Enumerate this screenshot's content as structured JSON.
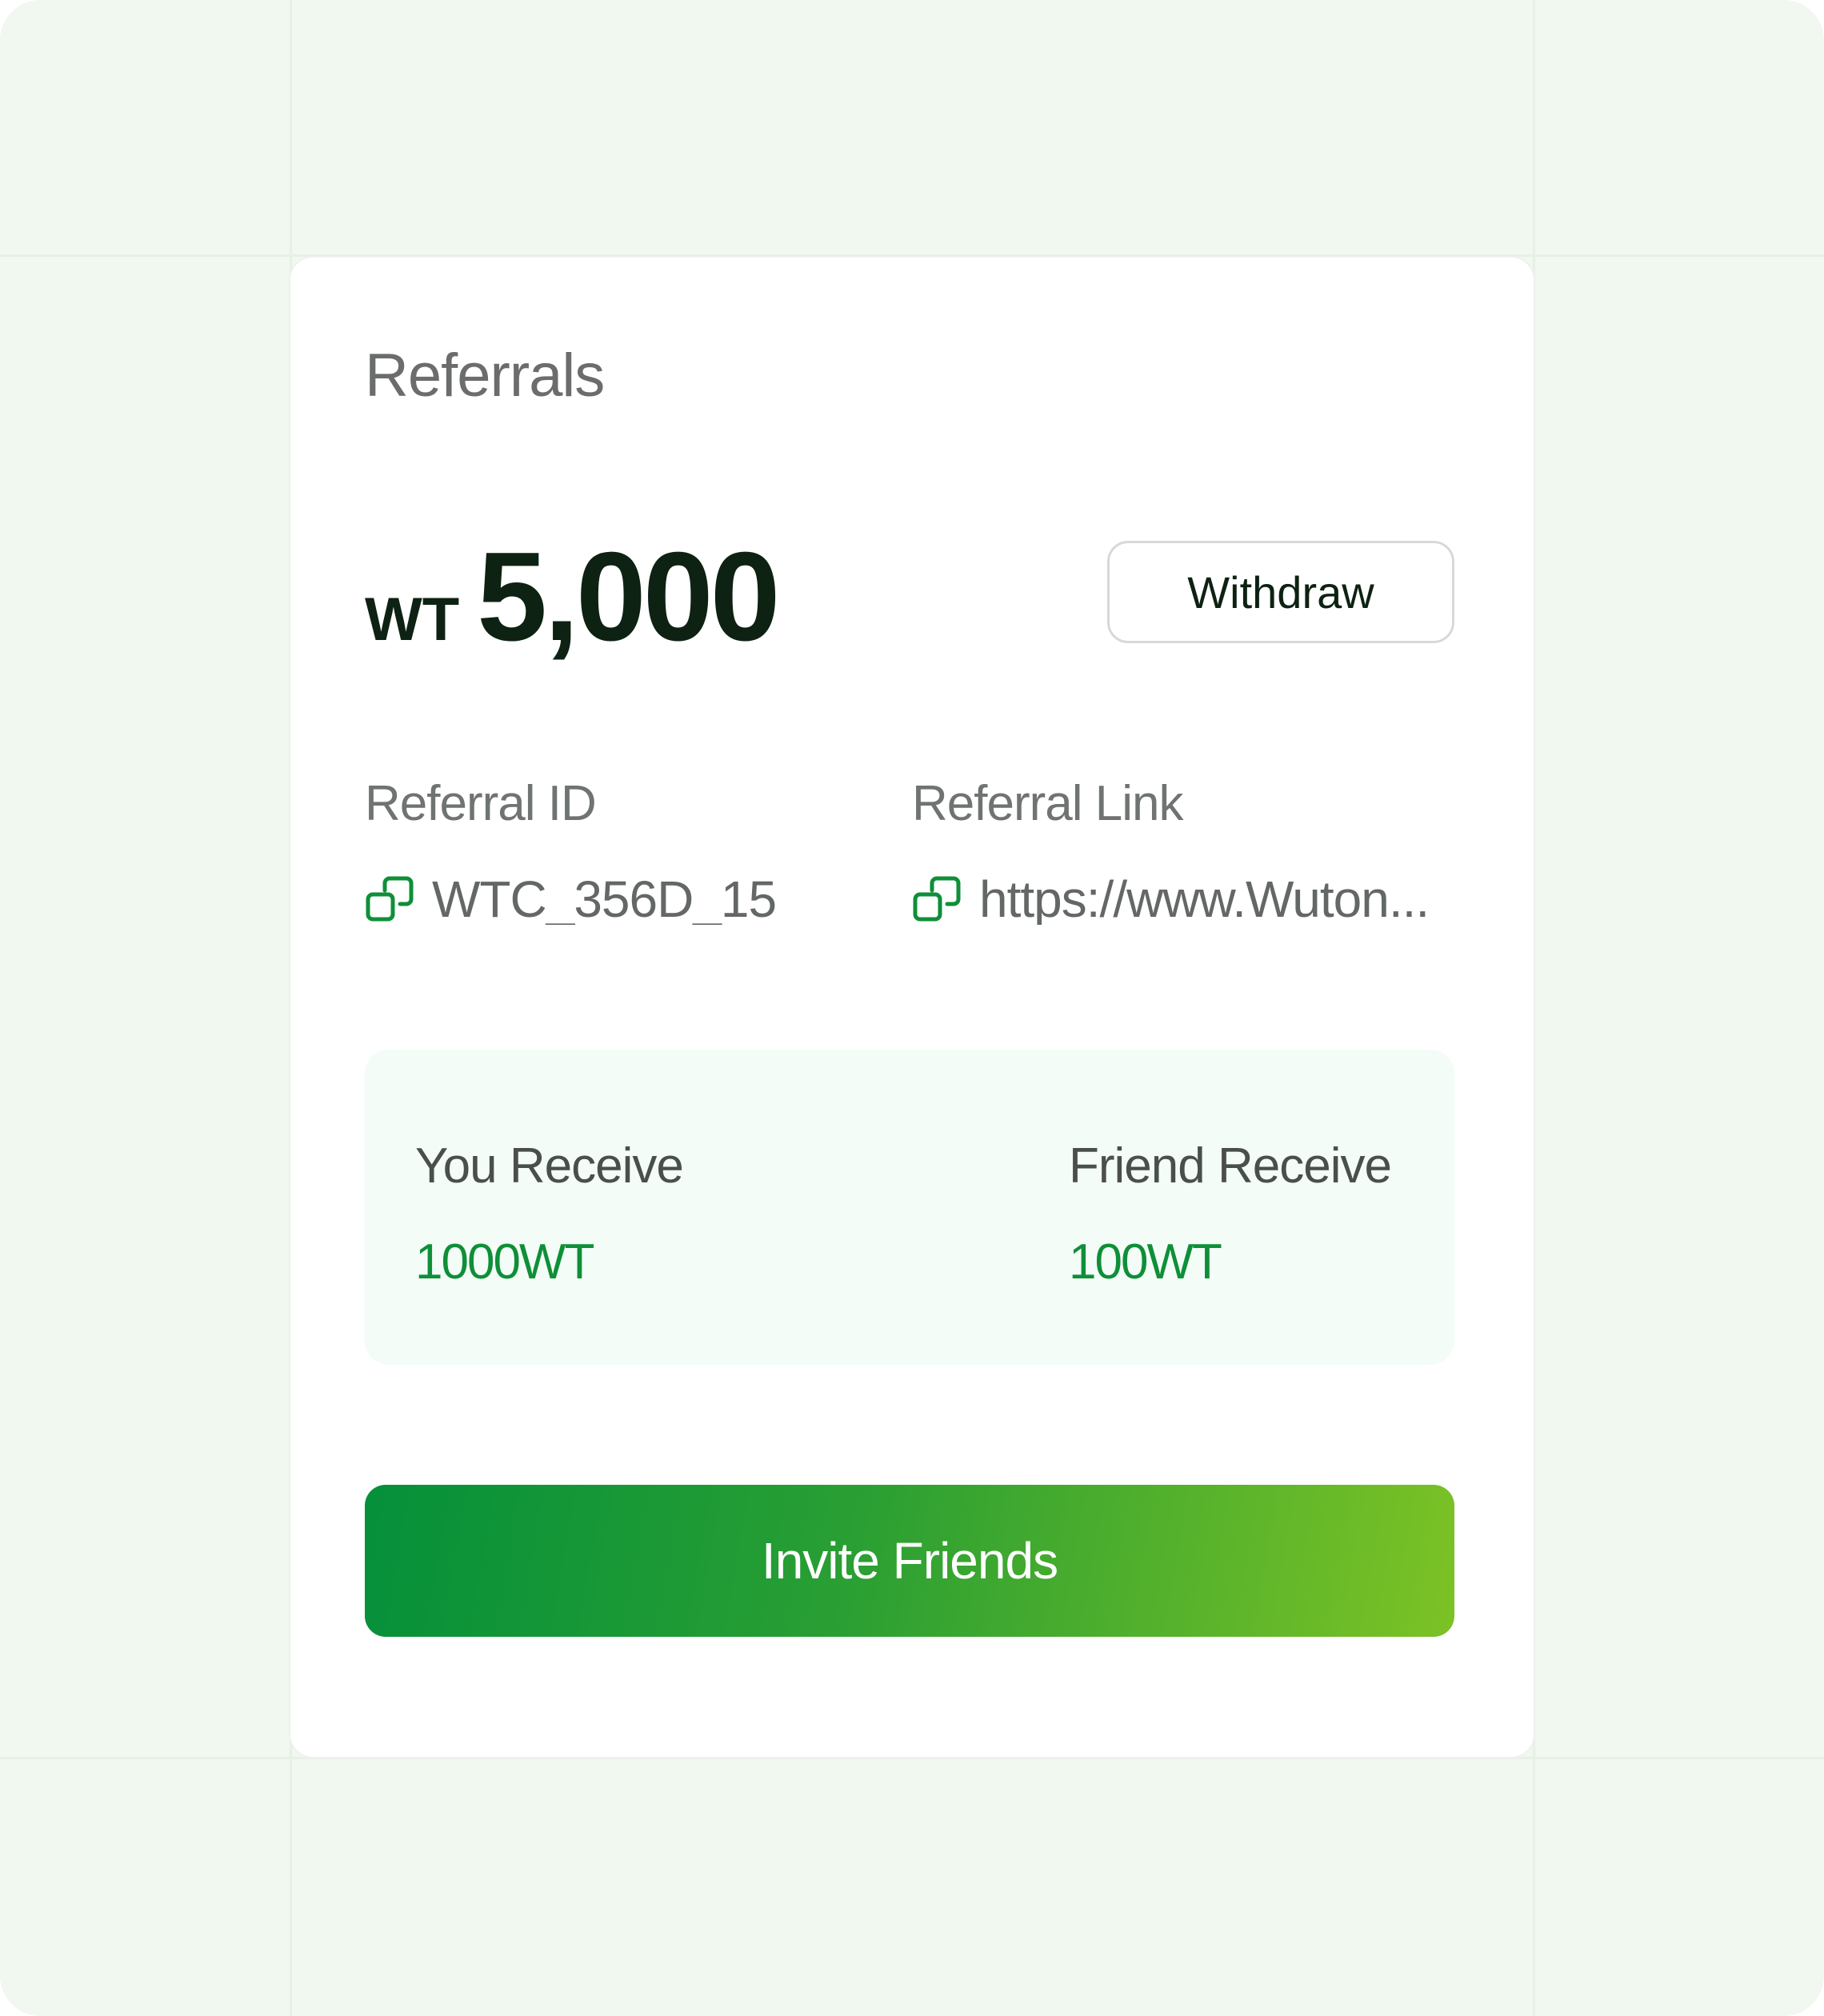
{
  "referrals": {
    "title": "Referrals",
    "balance": {
      "currency": "WT",
      "amount": "5,000"
    },
    "withdraw_label": "Withdraw",
    "referral_id": {
      "label": "Referral ID",
      "value": "WTC_356D_15"
    },
    "referral_link": {
      "label": "Referral Link",
      "value": "https://www.Wuton..."
    },
    "rewards": {
      "you_label": "You Receive",
      "you_value": "1000WT",
      "friend_label": "Friend Receive",
      "friend_value": "100WT"
    },
    "invite_label": "Invite Friends"
  },
  "colors": {
    "accent": "#0e8f38",
    "gradient_start": "#05903a",
    "gradient_end": "#7cc225",
    "background": "#f1f8ef"
  },
  "icons": {
    "copy": "copy-icon"
  }
}
